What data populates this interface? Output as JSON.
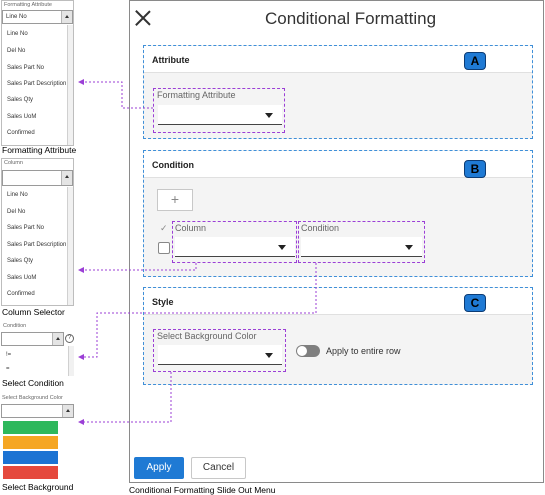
{
  "panel": {
    "title": "Conditional Formatting",
    "caption": "Conditional Formatting Slide Out Menu",
    "apply_label": "Apply",
    "cancel_label": "Cancel"
  },
  "sections": {
    "attribute": {
      "title": "Attribute",
      "badge": "A",
      "field_label": "Formatting Attribute"
    },
    "condition": {
      "title": "Condition",
      "badge": "B",
      "column_label": "Column",
      "condition_label": "Condition",
      "add_label": "+",
      "tick": "✓"
    },
    "style": {
      "title": "Style",
      "badge": "C",
      "bg_label": "Select Background Color",
      "toggle_label": "Apply to entire row"
    }
  },
  "left": {
    "formatting_attribute": {
      "header": "Formatting Attribute",
      "selected": "Line No",
      "options": [
        "Line No",
        "Del No",
        "Sales Part No",
        "Sales Part Description",
        "Sales Qty",
        "Sales UoM",
        "Confirmed"
      ],
      "caption": "Formatting Attribute"
    },
    "column_selector": {
      "header": "Column",
      "selected": "",
      "options": [
        "Line No",
        "Del No",
        "Sales Part No",
        "Sales Part Description",
        "Sales Qty",
        "Sales UoM",
        "Confirmed"
      ],
      "caption": "Column Selector"
    },
    "select_condition": {
      "header": "Condition",
      "options": [
        "!=",
        "="
      ],
      "help": "?",
      "caption": "Select Condition"
    },
    "select_background": {
      "header": "Select Background Color",
      "swatches": [
        "#2eb85c",
        "#f5a623",
        "#1c73d3",
        "#e5493d"
      ],
      "caption": "Select Background"
    }
  },
  "colors": {
    "accent": "#1f7ad4",
    "connector": "#9b3fd6",
    "section_border": "#3f8fd8"
  }
}
